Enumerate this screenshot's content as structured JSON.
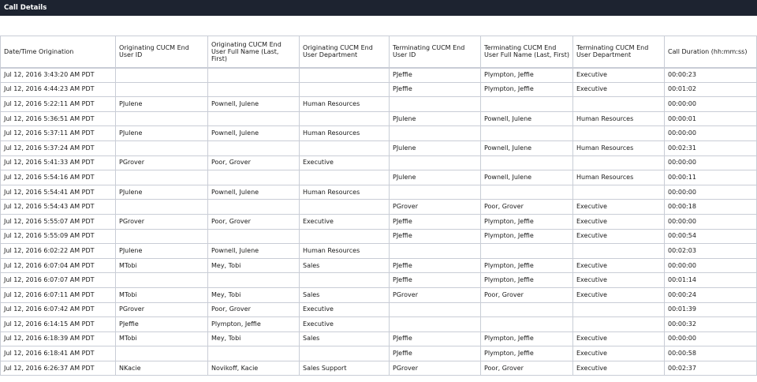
{
  "panel": {
    "title": "Call Details"
  },
  "table": {
    "columns": [
      "Date/Time Origination",
      "Originating CUCM End User ID",
      "Originating CUCM End User Full Name (Last, First)",
      "Originating CUCM End User Department",
      "Terminating CUCM End User ID",
      "Terminating CUCM End User Full Name (Last, First)",
      "Terminating CUCM End User Department",
      "Call Duration (hh:mm:ss)"
    ],
    "rows": [
      [
        "Jul 12, 2016 3:43:20 AM PDT",
        "",
        "",
        "",
        "PJeffie",
        "Plympton, Jeffie",
        "Executive",
        "00:00:23"
      ],
      [
        "Jul 12, 2016 4:44:23 AM PDT",
        "",
        "",
        "",
        "PJeffie",
        "Plympton, Jeffie",
        "Executive",
        "00:01:02"
      ],
      [
        "Jul 12, 2016 5:22:11 AM PDT",
        "PJulene",
        "Pownell, Julene",
        "Human Resources",
        "",
        "",
        "",
        "00:00:00"
      ],
      [
        "Jul 12, 2016 5:36:51 AM PDT",
        "",
        "",
        "",
        "PJulene",
        "Pownell, Julene",
        "Human Resources",
        "00:00:01"
      ],
      [
        "Jul 12, 2016 5:37:11 AM PDT",
        "PJulene",
        "Pownell, Julene",
        "Human Resources",
        "",
        "",
        "",
        "00:00:00"
      ],
      [
        "Jul 12, 2016 5:37:24 AM PDT",
        "",
        "",
        "",
        "PJulene",
        "Pownell, Julene",
        "Human Resources",
        "00:02:31"
      ],
      [
        "Jul 12, 2016 5:41:33 AM PDT",
        "PGrover",
        "Poor, Grover",
        "Executive",
        "",
        "",
        "",
        "00:00:00"
      ],
      [
        "Jul 12, 2016 5:54:16 AM PDT",
        "",
        "",
        "",
        "PJulene",
        "Pownell, Julene",
        "Human Resources",
        "00:00:11"
      ],
      [
        "Jul 12, 2016 5:54:41 AM PDT",
        "PJulene",
        "Pownell, Julene",
        "Human Resources",
        "",
        "",
        "",
        "00:00:00"
      ],
      [
        "Jul 12, 2016 5:54:43 AM PDT",
        "",
        "",
        "",
        "PGrover",
        "Poor, Grover",
        "Executive",
        "00:00:18"
      ],
      [
        "Jul 12, 2016 5:55:07 AM PDT",
        "PGrover",
        "Poor, Grover",
        "Executive",
        "PJeffie",
        "Plympton, Jeffie",
        "Executive",
        "00:00:00"
      ],
      [
        "Jul 12, 2016 5:55:09 AM PDT",
        "",
        "",
        "",
        "PJeffie",
        "Plympton, Jeffie",
        "Executive",
        "00:00:54"
      ],
      [
        "Jul 12, 2016 6:02:22 AM PDT",
        "PJulene",
        "Pownell, Julene",
        "Human Resources",
        "",
        "",
        "",
        "00:02:03"
      ],
      [
        "Jul 12, 2016 6:07:04 AM PDT",
        "MTobi",
        "Mey, Tobi",
        "Sales",
        "PJeffie",
        "Plympton, Jeffie",
        "Executive",
        "00:00:00"
      ],
      [
        "Jul 12, 2016 6:07:07 AM PDT",
        "",
        "",
        "",
        "PJeffie",
        "Plympton, Jeffie",
        "Executive",
        "00:01:14"
      ],
      [
        "Jul 12, 2016 6:07:11 AM PDT",
        "MTobi",
        "Mey, Tobi",
        "Sales",
        "PGrover",
        "Poor, Grover",
        "Executive",
        "00:00:24"
      ],
      [
        "Jul 12, 2016 6:07:42 AM PDT",
        "PGrover",
        "Poor, Grover",
        "Executive",
        "",
        "",
        "",
        "00:01:39"
      ],
      [
        "Jul 12, 2016 6:14:15 AM PDT",
        "PJeffie",
        "Plympton, Jeffie",
        "Executive",
        "",
        "",
        "",
        "00:00:32"
      ],
      [
        "Jul 12, 2016 6:18:39 AM PDT",
        "MTobi",
        "Mey, Tobi",
        "Sales",
        "PJeffie",
        "Plympton, Jeffie",
        "Executive",
        "00:00:00"
      ],
      [
        "Jul 12, 2016 6:18:41 AM PDT",
        "",
        "",
        "",
        "PJeffie",
        "Plympton, Jeffie",
        "Executive",
        "00:00:58"
      ],
      [
        "Jul 12, 2016 6:26:37 AM PDT",
        "NKacie",
        "Novikoff, Kacie",
        "Sales Support",
        "PGrover",
        "Poor, Grover",
        "Executive",
        "00:02:37"
      ]
    ]
  }
}
